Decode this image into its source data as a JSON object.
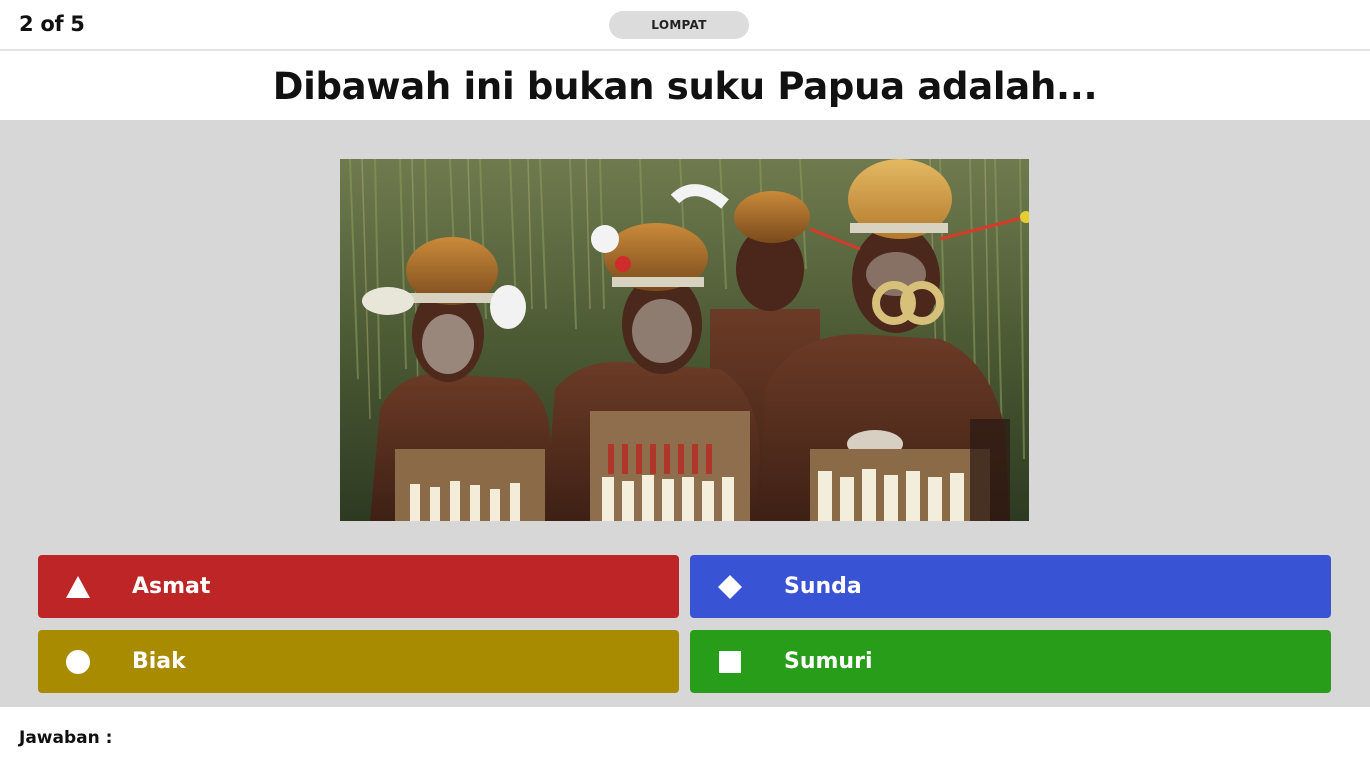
{
  "header": {
    "progress": "2 of 5",
    "skip_label": "LOMPAT"
  },
  "question": {
    "text": "Dibawah ini bukan suku Papua adalah..."
  },
  "image": {
    "icon": "photo-papua-tribesmen"
  },
  "answers": [
    {
      "label": "Asmat",
      "shape": "triangle-icon",
      "color": "#be2527"
    },
    {
      "label": "Sunda",
      "shape": "diamond-icon",
      "color": "#3853d3"
    },
    {
      "label": "Biak",
      "shape": "circle-icon",
      "color": "#a88b00"
    },
    {
      "label": "Sumuri",
      "shape": "square-icon",
      "color": "#279d19"
    }
  ],
  "footer": {
    "answer_label": "Jawaban :"
  }
}
